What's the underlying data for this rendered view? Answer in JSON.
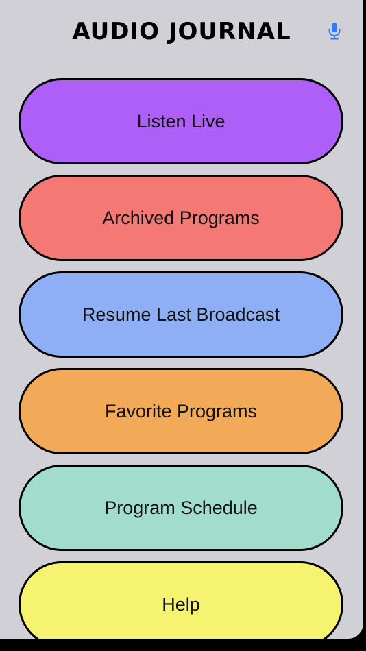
{
  "header": {
    "title": "AUDIO JOURNAL",
    "mic_icon": "microphone-icon",
    "accent_color": "#2f7cf6"
  },
  "menu": {
    "items": [
      {
        "label": "Listen Live",
        "color": "#ad5ff7"
      },
      {
        "label": "Archived Programs",
        "color": "#f47975"
      },
      {
        "label": "Resume Last Broadcast",
        "color": "#8eaef5"
      },
      {
        "label": "Favorite Programs",
        "color": "#f3aa58"
      },
      {
        "label": "Program Schedule",
        "color": "#a2dccc"
      },
      {
        "label": "Help",
        "color": "#f5f370"
      }
    ]
  }
}
